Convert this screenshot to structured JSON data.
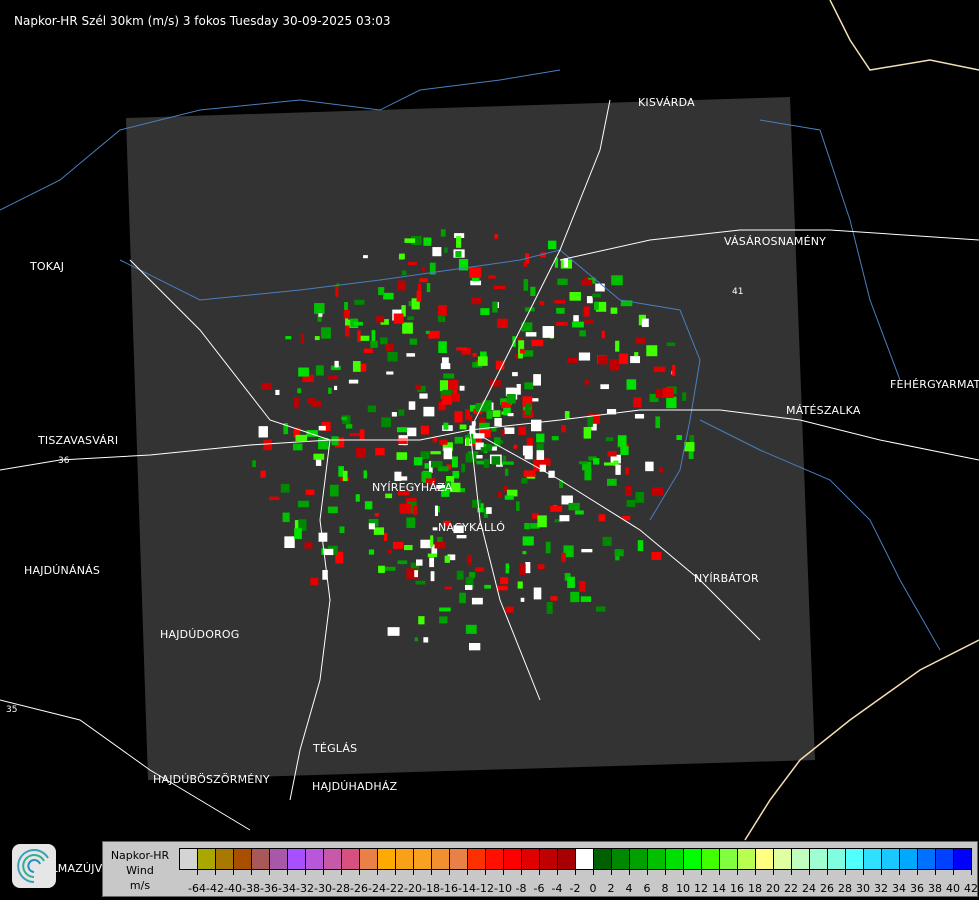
{
  "title": "Napkor-HR Szél 30km (m/s) 3 fokos Tuesday 30-09-2025 03:03",
  "cities": [
    {
      "name": "KISVÁRDA"
    },
    {
      "name": "TOKAJ"
    },
    {
      "name": "VÁSÁROSNAMÉNY"
    },
    {
      "name": "FEHÉRGYARMAT"
    },
    {
      "name": "MÁTÉSZALKA"
    },
    {
      "name": "TISZAVASVÁRI"
    },
    {
      "name": "NYÍREGYHÁZA"
    },
    {
      "name": "NAGYKÁLLÓ"
    },
    {
      "name": "HAJDÚNÁNÁS"
    },
    {
      "name": "NYÍRBÁTOR"
    },
    {
      "name": "HAJDÚDOROG"
    },
    {
      "name": "TÉGLÁS"
    },
    {
      "name": "HAJDÚBÖSZÖRMÉNY"
    },
    {
      "name": "HAJDÚHADHÁZ"
    },
    {
      "name": "BALMAZÚJVÁROS"
    }
  ],
  "road_numbers": [
    "36",
    "41",
    "35"
  ],
  "legend": {
    "product": "Napkor-HR",
    "quantity": "Wind",
    "unit": "m/s",
    "labels": [
      "-64",
      "-42",
      "-40",
      "-38",
      "-36",
      "-34",
      "-32",
      "-30",
      "-28",
      "-26",
      "-24",
      "-22",
      "-20",
      "-18",
      "-16",
      "-14",
      "-12",
      "-10",
      "-8",
      "-6",
      "-4",
      "-2",
      "0",
      "2",
      "4",
      "6",
      "8",
      "10",
      "12",
      "14",
      "16",
      "18",
      "20",
      "22",
      "24",
      "26",
      "28",
      "30",
      "32",
      "34",
      "36",
      "38",
      "40",
      "42"
    ],
    "colors": [
      "#d4d4d4",
      "#a8a800",
      "#a87800",
      "#a85000",
      "#a85858",
      "#a858a8",
      "#a850ff",
      "#b858d8",
      "#c858a8",
      "#d85080",
      "#e88048",
      "#ffaa00",
      "#f8a018",
      "#f8a020",
      "#f09030",
      "#e88048",
      "#ff3000",
      "#ff1000",
      "#ff0000",
      "#e00000",
      "#c00000",
      "#a80000",
      "#ffffff",
      "#006000",
      "#008800",
      "#00a000",
      "#00c000",
      "#00e000",
      "#00ff00",
      "#40ff00",
      "#80ff40",
      "#b8ff50",
      "#ffff80",
      "#e0ffa0",
      "#c0ffc0",
      "#a0ffd0",
      "#80ffe0",
      "#50ffff",
      "#30e0ff",
      "#18c8ff",
      "#00a8ff",
      "#0070ff",
      "#0040ff",
      "#0000ff"
    ]
  },
  "colors": {
    "radar_area": "#333333",
    "rivers": "#4a7fc0",
    "border": "#f5deb3",
    "roads": "#ffffff"
  }
}
